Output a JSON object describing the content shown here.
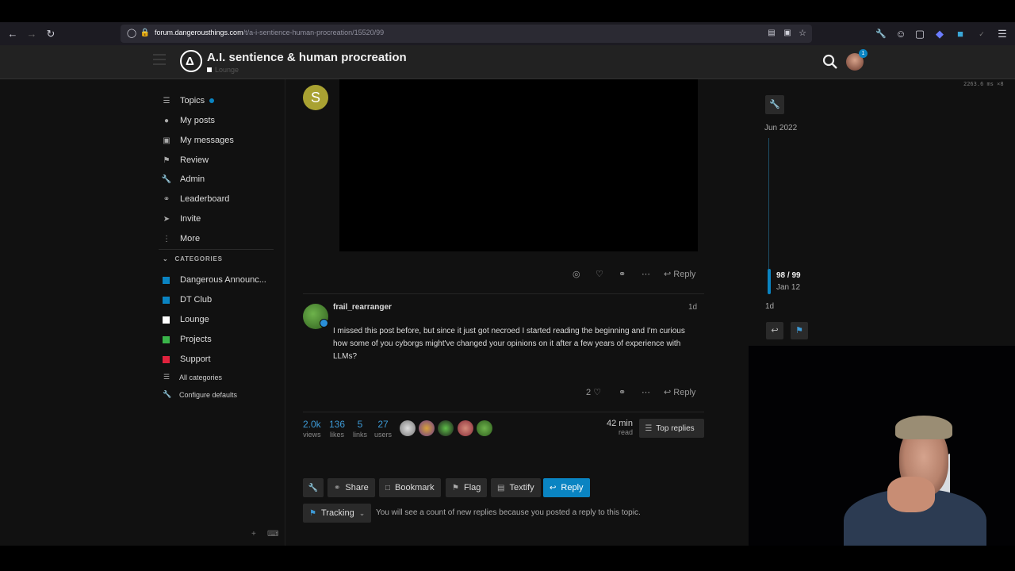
{
  "browser": {
    "url_host": "forum.dangerousthings.com",
    "url_path": "/t/a-i-sentience-human-procreation/15520/99",
    "icons": [
      "back-icon",
      "forward-icon",
      "reload-icon",
      "shield-icon",
      "lock-icon",
      "reader-icon",
      "screenshot-icon",
      "star-icon",
      "wrench-icon",
      "account-icon",
      "extensions-icon",
      "extension-badge-icon",
      "menu-icon"
    ]
  },
  "header": {
    "title": "A.I. sentience & human procreation",
    "category": "Lounge",
    "notification_count": "1",
    "perf": "2263.6 ms ×8"
  },
  "sidebar": {
    "items": [
      {
        "label": "Topics",
        "icon": "layers-icon"
      },
      {
        "label": "My posts",
        "icon": "user-icon"
      },
      {
        "label": "My messages",
        "icon": "inbox-icon"
      },
      {
        "label": "Review",
        "icon": "flag-icon"
      },
      {
        "label": "Admin",
        "icon": "wrench-icon"
      },
      {
        "label": "Leaderboard",
        "icon": "link-icon"
      },
      {
        "label": "Invite",
        "icon": "send-icon"
      },
      {
        "label": "More",
        "icon": "more-vertical-icon"
      }
    ],
    "categories_heading": "CATEGORIES",
    "categories": [
      {
        "label": "Dangerous Announc...",
        "color": "#0a84c2"
      },
      {
        "label": "DT Club",
        "color": "#0a84c2"
      },
      {
        "label": "Lounge",
        "color": "#ffffff"
      },
      {
        "label": "Projects",
        "color": "#3ab54a"
      },
      {
        "label": "Support",
        "color": "#e0223d"
      }
    ],
    "all_categories": "All categories",
    "configure_defaults": "Configure defaults"
  },
  "posts": {
    "first_avatar_letter": "S",
    "first_reply": "Reply",
    "second": {
      "username": "frail_rearranger",
      "age": "1d",
      "body": "I missed this post before, but since it just got necroed I started reading the beginning and I'm curious how some of you cyborgs might've changed your opinions on it after a few years of experience with LLMs?",
      "likes": "2",
      "reply": "Reply"
    }
  },
  "stats": {
    "views": {
      "num": "2.0k",
      "lbl": "views"
    },
    "likes": {
      "num": "136",
      "lbl": "likes"
    },
    "links": {
      "num": "5",
      "lbl": "links"
    },
    "users": {
      "num": "27",
      "lbl": "users"
    },
    "read_num": "42 min",
    "read_lbl": "read",
    "top_replies": "Top replies"
  },
  "footer_buttons": {
    "share": "Share",
    "bookmark": "Bookmark",
    "flag": "Flag",
    "textify": "Textify",
    "reply": "Reply"
  },
  "tracking": {
    "label": "Tracking",
    "description": "You will see a count of new replies because you posted a reply to this topic."
  },
  "timeline": {
    "start": "Jun 2022",
    "position": "98 / 99",
    "date": "Jan 12",
    "end": "1d"
  },
  "colors": {
    "accent": "#0a84c2",
    "background": "#111111",
    "header": "#222222"
  }
}
